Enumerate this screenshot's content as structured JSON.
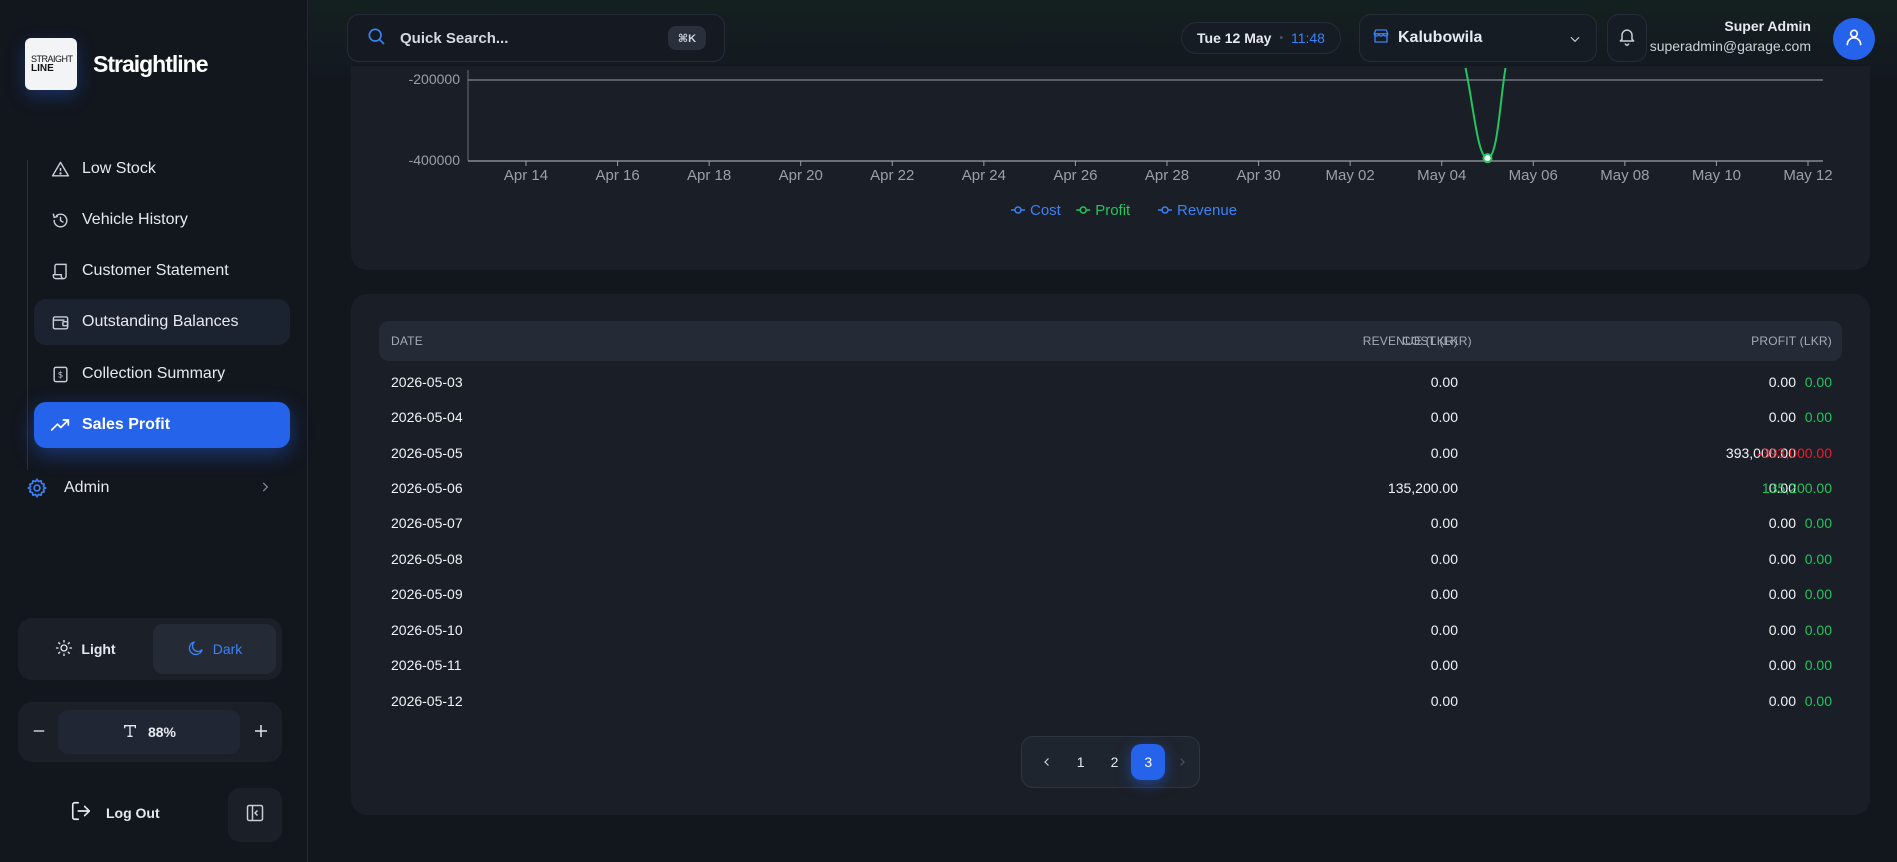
{
  "brand": {
    "logo_line1": "STRAIGHT",
    "logo_line2": "LINE",
    "name": "Straightline"
  },
  "sidebar": {
    "items": [
      {
        "label": "Low Stock",
        "icon": "warning-icon"
      },
      {
        "label": "Vehicle History",
        "icon": "history-icon"
      },
      {
        "label": "Customer Statement",
        "icon": "scroll-icon"
      },
      {
        "label": "Outstanding Balances",
        "icon": "wallet-icon"
      },
      {
        "label": "Collection Summary",
        "icon": "receipt-icon"
      },
      {
        "label": "Sales Profit",
        "icon": "trending-up-icon"
      }
    ],
    "active": "Sales Profit",
    "admin_label": "Admin",
    "theme": {
      "light_label": "Light",
      "dark_label": "Dark",
      "selected": "Dark"
    },
    "zoom": {
      "value": "88%"
    },
    "logout_label": "Log Out"
  },
  "topbar": {
    "search_placeholder": "Quick Search...",
    "shortcut": "⌘K",
    "date": "Tue 12 May",
    "time": "11:48",
    "branch": "Kalubowila",
    "user_name": "Super Admin",
    "user_email": "superadmin@garage.com"
  },
  "chart_data": {
    "type": "line",
    "x": [
      "Apr 14",
      "Apr 16",
      "Apr 18",
      "Apr 20",
      "Apr 22",
      "Apr 24",
      "Apr 26",
      "Apr 28",
      "Apr 30",
      "May 02",
      "May 04",
      "May 06",
      "May 08",
      "May 10",
      "May 12"
    ],
    "y_ticks_visible": [
      "-200000",
      "-400000"
    ],
    "series": [
      {
        "name": "Cost",
        "color": "#3b82f6"
      },
      {
        "name": "Profit",
        "color": "#22c55e",
        "points": [
          [
            "May 04",
            -200000
          ],
          [
            "May 05",
            -393000
          ],
          [
            "May 06",
            -200000
          ]
        ]
      },
      {
        "name": "Revenue",
        "color": "#3b82f6"
      }
    ],
    "ylim": [
      -400000,
      -200000
    ],
    "legend": "bottom-center"
  },
  "table": {
    "headers": [
      "DATE",
      "REVENUE (LKR)",
      "COST (LKR)",
      "PROFIT (LKR)"
    ],
    "rows": [
      [
        "2026-05-03",
        "0.00",
        "0.00",
        "0.00"
      ],
      [
        "2026-05-04",
        "0.00",
        "0.00",
        "0.00"
      ],
      [
        "2026-05-05",
        "0.00",
        "393,000.00",
        "-393,000.00"
      ],
      [
        "2026-05-06",
        "135,200.00",
        "0.00",
        "135,200.00"
      ],
      [
        "2026-05-07",
        "0.00",
        "0.00",
        "0.00"
      ],
      [
        "2026-05-08",
        "0.00",
        "0.00",
        "0.00"
      ],
      [
        "2026-05-09",
        "0.00",
        "0.00",
        "0.00"
      ],
      [
        "2026-05-10",
        "0.00",
        "0.00",
        "0.00"
      ],
      [
        "2026-05-11",
        "0.00",
        "0.00",
        "0.00"
      ],
      [
        "2026-05-12",
        "0.00",
        "0.00",
        "0.00"
      ]
    ]
  },
  "pagination": {
    "pages": [
      "1",
      "2",
      "3"
    ],
    "current": "3"
  },
  "colors": {
    "accent": "#2563eb",
    "profit_positive": "#22c55e",
    "profit_negative": "#ef1c2f",
    "background": "#12161d",
    "card": "#1a1e26"
  }
}
